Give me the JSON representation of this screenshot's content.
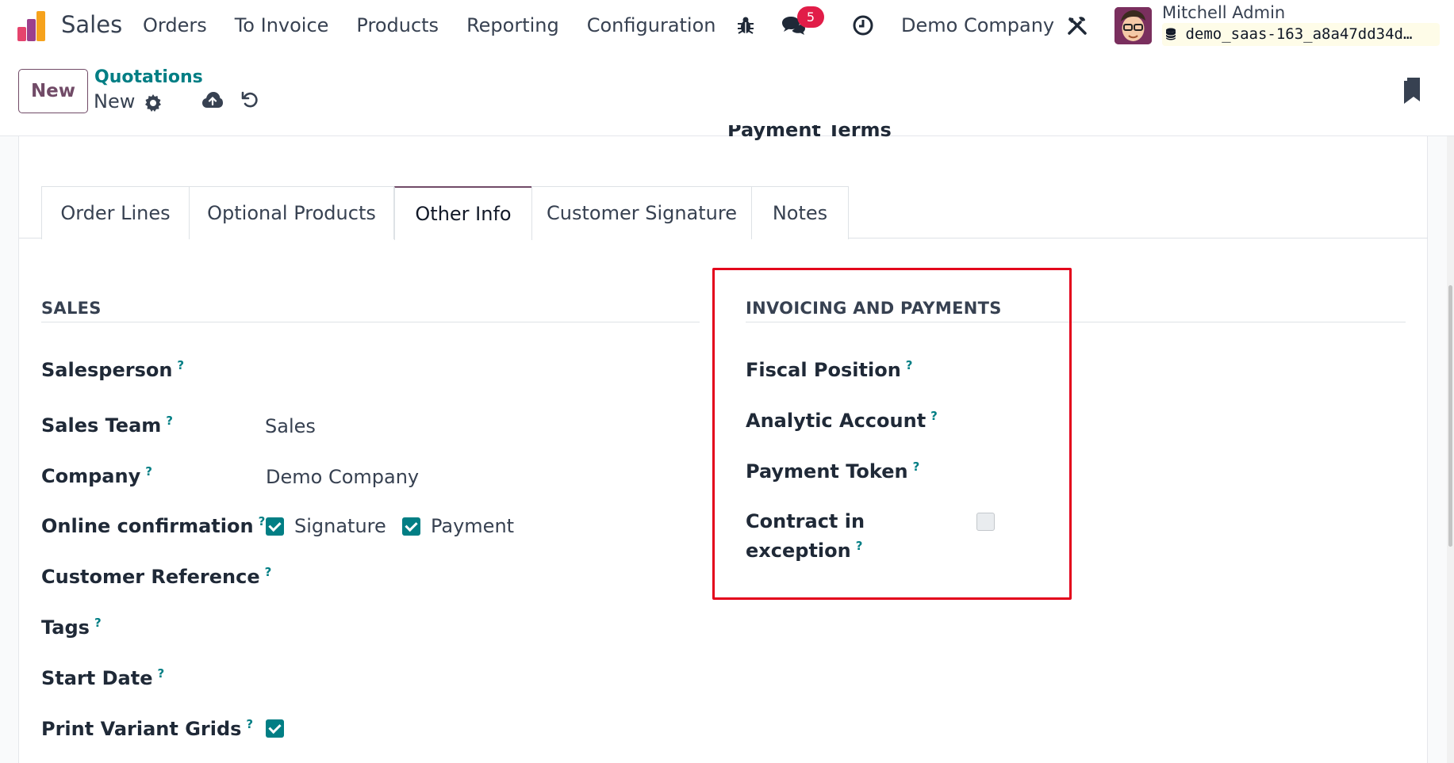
{
  "navbar": {
    "brand": "Sales",
    "menu": [
      "Orders",
      "To Invoice",
      "Products",
      "Reporting",
      "Configuration"
    ],
    "chat_count": "5",
    "company": "Demo Company",
    "user_name": "Mitchell Admin",
    "database": "demo_saas-163_a8a47dd34d…"
  },
  "control_panel": {
    "new_label": "New",
    "breadcrumb_parent": "Quotations",
    "breadcrumb_current": "New"
  },
  "form": {
    "cutoff_label": "Payment Terms",
    "tabs": [
      "Order Lines",
      "Optional Products",
      "Other Info",
      "Customer Signature",
      "Notes"
    ],
    "active_tab": "Other Info",
    "help_mark": "?",
    "sales": {
      "title": "SALES",
      "salesperson_label": "Salesperson",
      "sales_team_label": "Sales Team",
      "sales_team_value": "Sales",
      "company_label": "Company",
      "company_value": "Demo Company",
      "online_confirmation_label": "Online confirmation",
      "signature_label": "Signature",
      "signature_checked": true,
      "payment_label": "Payment",
      "payment_checked": true,
      "customer_reference_label": "Customer Reference",
      "tags_label": "Tags",
      "start_date_label": "Start Date",
      "print_variant_grids_label": "Print Variant Grids",
      "print_variant_grids_checked": true
    },
    "invoicing": {
      "title": "INVOICING AND PAYMENTS",
      "fiscal_position_label": "Fiscal Position",
      "analytic_account_label": "Analytic Account",
      "payment_token_label": "Payment Token",
      "contract_exception_line1": "Contract in",
      "contract_exception_line2": "exception",
      "contract_exception_checked": false
    }
  },
  "colors": {
    "brand_purple": "#714b67",
    "teal": "#017e84",
    "highlight_red": "#e3001b",
    "badge_red": "#e11d48"
  },
  "icons": {
    "app_logo": "sales-app-logo",
    "bug": "bug-icon",
    "chat": "chat-icon",
    "activity": "clock-icon",
    "tools": "tools-icon",
    "database": "database-icon",
    "gear": "gear-icon",
    "save": "cloud-upload-icon",
    "discard": "undo-icon",
    "bookmark": "bookmark-icon"
  }
}
